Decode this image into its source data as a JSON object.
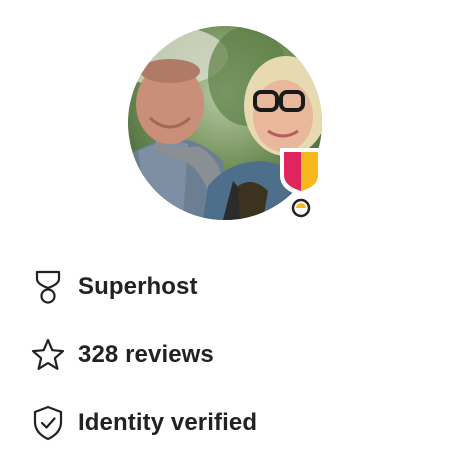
{
  "host_profile": {
    "photo_alt": "Host photo",
    "badge_icon": "superhost-badge-icon"
  },
  "stats": {
    "superhost": {
      "label": "Superhost",
      "icon": "superhost-medal-icon"
    },
    "reviews": {
      "label": "328 reviews",
      "icon": "star-icon"
    },
    "identity": {
      "label": "Identity verified",
      "icon": "shield-check-icon"
    }
  },
  "colors": {
    "text": "#222222",
    "badge_red": "#e0245e",
    "badge_yellow": "#f7b81b"
  }
}
